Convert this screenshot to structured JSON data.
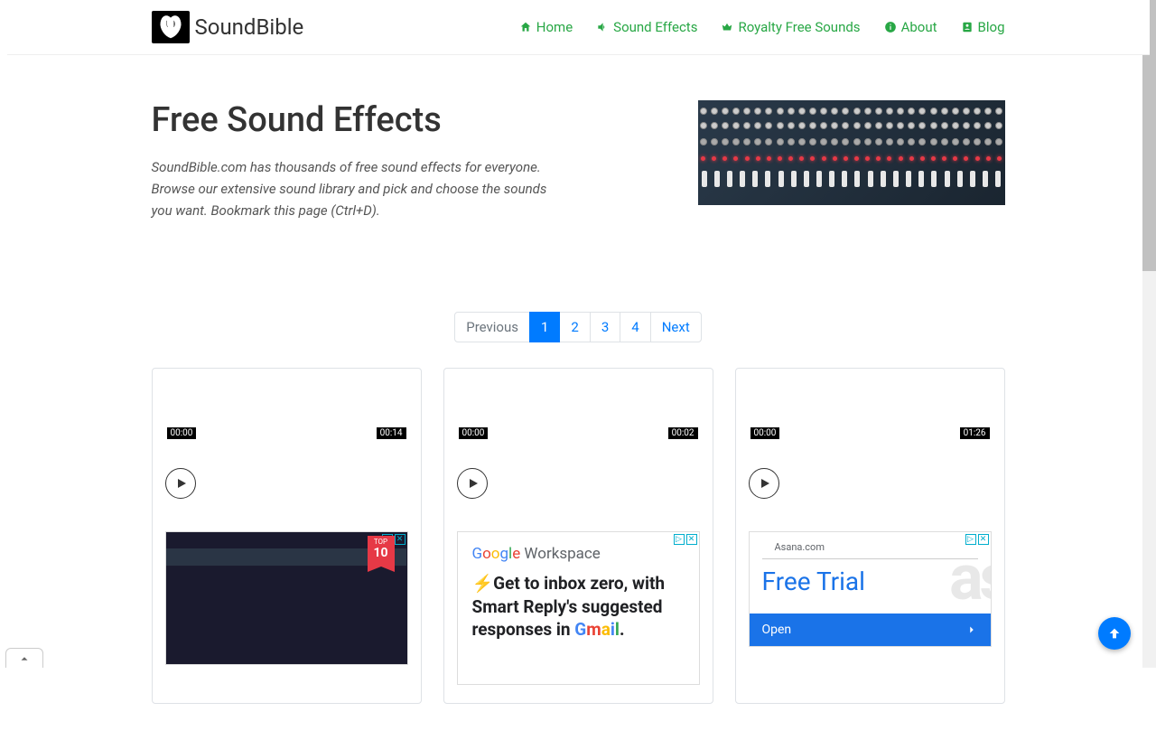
{
  "brand": "SoundBible",
  "nav": {
    "home": "Home",
    "effects": "Sound Effects",
    "royalty": "Royalty Free Sounds",
    "about": "About",
    "blog": "Blog"
  },
  "hero": {
    "title": "Free Sound Effects",
    "desc": "SoundBible.com has thousands of free sound effects for everyone. Browse our extensive sound library and pick and choose the sounds you want. Bookmark this page (Ctrl+D)."
  },
  "pagination": {
    "prev": "Previous",
    "pages": [
      "1",
      "2",
      "3",
      "4"
    ],
    "next": "Next",
    "active": "1"
  },
  "cards": [
    {
      "start": "00:00",
      "end": "00:14"
    },
    {
      "start": "00:00",
      "end": "00:02"
    },
    {
      "start": "00:00",
      "end": "01:26"
    }
  ],
  "ads": {
    "ad1": {
      "badge_top": "TOP",
      "badge_num": "10"
    },
    "ad2": {
      "brand": "Workspace",
      "text_prefix": "Get to inbox zero, with Smart Reply's suggested responses in ",
      "text_suffix": "mail."
    },
    "ad3": {
      "domain": "Asana.com",
      "title": "Free Trial",
      "cta": "Open"
    }
  }
}
